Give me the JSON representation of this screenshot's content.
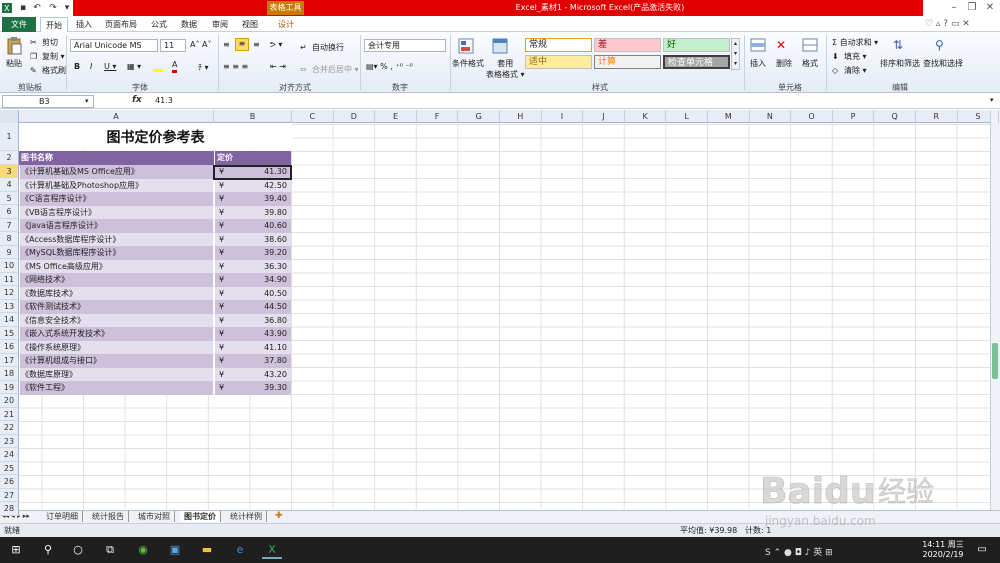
{
  "title_bar": {
    "tool_tab": "表格工具",
    "window_title": "Excel_素材1 - Microsoft Excel(产品激活失败)",
    "design_tab": "设计"
  },
  "menu": {
    "file": "文件",
    "home": "开始",
    "insert": "插入",
    "page_layout": "页面布局",
    "formulas": "公式",
    "data": "数据",
    "review": "审阅",
    "view": "视图"
  },
  "ribbon": {
    "clipboard": {
      "paste": "粘贴",
      "cut": "剪切",
      "copy": "复制 ▾",
      "format_painter": "格式刷",
      "label": "剪贴板"
    },
    "font": {
      "name": "Arial Unicode MS",
      "size": "11",
      "label": "字体"
    },
    "alignment": {
      "wrap": "自动换行",
      "merge": "合并后居中 ▾",
      "label": "对齐方式"
    },
    "number": {
      "format": "会计专用",
      "label": "数字"
    },
    "styles": {
      "conditional": "条件格式",
      "table_format": "套用\n表格格式 ▾",
      "normal": "常规",
      "bad": "差",
      "good": "好",
      "neutral": "适中",
      "calc": "计算",
      "check": "检查单元格",
      "label": "样式"
    },
    "cells": {
      "insert": "插入",
      "delete": "删除",
      "format": "格式",
      "label": "单元格"
    },
    "editing": {
      "autosum": "Σ 自动求和 ▾",
      "fill": "填充 ▾",
      "clear": "清除 ▾",
      "sort": "排序和筛选",
      "find": "查找和选择",
      "label": "编辑"
    }
  },
  "formula_bar": {
    "name_box": "B3",
    "fx": "fx",
    "value": "41.3"
  },
  "columns": [
    "A",
    "B",
    "C",
    "D",
    "E",
    "F",
    "G",
    "H",
    "I",
    "J",
    "K",
    "L",
    "M",
    "N",
    "O",
    "P",
    "Q",
    "R",
    "S"
  ],
  "sheet": {
    "title": "图书定价参考表",
    "header": {
      "name": "图书名称",
      "price": "定价"
    },
    "currency": "¥",
    "rows": [
      {
        "name": "《计算机基础及MS Office应用》",
        "price": "41.30"
      },
      {
        "name": "《计算机基础及Photoshop应用》",
        "price": "42.50"
      },
      {
        "name": "《C语言程序设计》",
        "price": "39.40"
      },
      {
        "name": "《VB语言程序设计》",
        "price": "39.80"
      },
      {
        "name": "《Java语言程序设计》",
        "price": "40.60"
      },
      {
        "name": "《Access数据库程序设计》",
        "price": "38.60"
      },
      {
        "name": "《MySQL数据库程序设计》",
        "price": "39.20"
      },
      {
        "name": "《MS Office高级应用》",
        "price": "36.30"
      },
      {
        "name": "《网络技术》",
        "price": "34.90"
      },
      {
        "name": "《数据库技术》",
        "price": "40.50"
      },
      {
        "name": "《软件测试技术》",
        "price": "44.50"
      },
      {
        "name": "《信息安全技术》",
        "price": "36.80"
      },
      {
        "name": "《嵌入式系统开发技术》",
        "price": "43.90"
      },
      {
        "name": "《操作系统原理》",
        "price": "41.10"
      },
      {
        "name": "《计算机组成与接口》",
        "price": "37.80"
      },
      {
        "name": "《数据库原理》",
        "price": "43.20"
      },
      {
        "name": "《软件工程》",
        "price": "39.30"
      }
    ]
  },
  "row_numbers": [
    "1",
    "2",
    "3",
    "4",
    "5",
    "6",
    "7",
    "8",
    "9",
    "10",
    "11",
    "12",
    "13",
    "14",
    "15",
    "16",
    "17",
    "18",
    "19",
    "20",
    "21",
    "22",
    "23",
    "24",
    "25",
    "26",
    "27",
    "28"
  ],
  "sheet_tabs": [
    "订单明细",
    "统计报告",
    "城市对照",
    "图书定价",
    "统计样例"
  ],
  "status": {
    "ready": "就绪",
    "average": "平均值: ¥39.98",
    "count": "计数: 1"
  },
  "taskbar": {
    "time": "14:11 周三",
    "date": "2020/2/19"
  },
  "watermark": "Baidu经验 jingyan.baidu.com",
  "colors": {
    "header_bg": "#8064a2",
    "row_odd": "#ccc0da",
    "row_even": "#e4dfec",
    "accent": "#1e7145"
  }
}
